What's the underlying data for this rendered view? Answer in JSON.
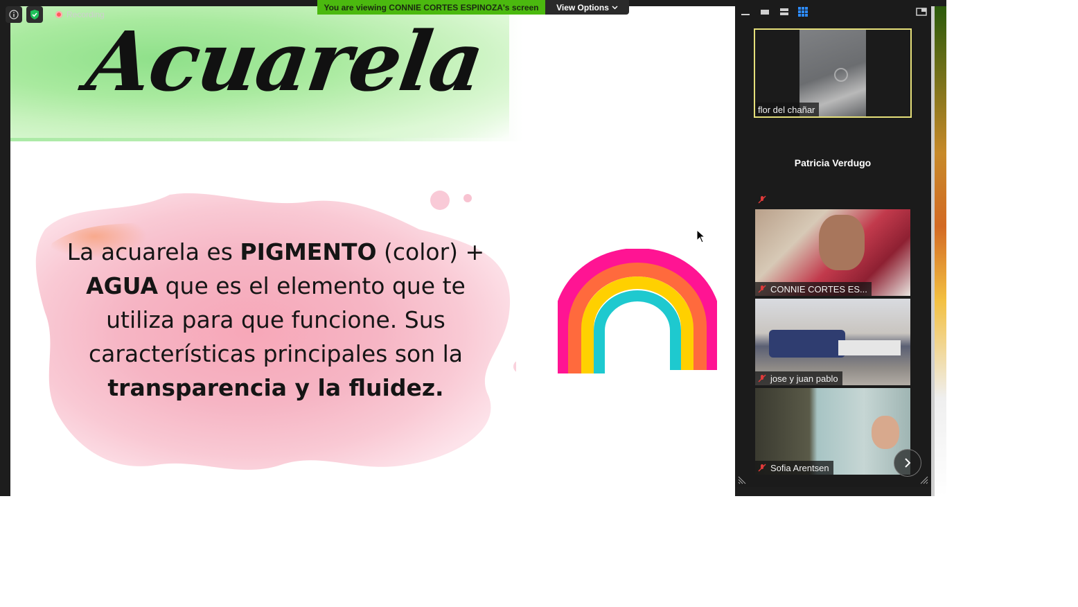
{
  "meeting": {
    "recording_label": "Recording",
    "viewing_banner": "You are viewing CONNIE CORTES ESPINOZA's screen",
    "view_options_label": "View Options"
  },
  "slide": {
    "title": "Acuarela",
    "text_parts": [
      "La acuarela es ",
      "PIGMENTO",
      " (color) + ",
      "AGUA",
      " que es el elemento que te utiliza para que funcione. Sus características principales son la ",
      "transparencia y la fluidez."
    ]
  },
  "participants": [
    {
      "name": "flor del chañar",
      "muted": false,
      "active": true
    },
    {
      "name": "Patricia Verdugo",
      "muted": true,
      "video": false
    },
    {
      "name": "CONNIE CORTES ES...",
      "muted": true
    },
    {
      "name": "jose y juan pablo",
      "muted": true
    },
    {
      "name": "Sofia Arentsen",
      "muted": true
    }
  ],
  "colors": {
    "banner_green": "#4bb90f",
    "active_speaker": "#e6e07a",
    "panel_bg": "#1b1b1b"
  },
  "icons": [
    "info-icon",
    "shield-check-icon",
    "record-icon",
    "chevron-down-icon",
    "minimize-icon",
    "speaker-view-icon",
    "strip-view-icon",
    "grid-view-icon",
    "popout-icon",
    "mic-muted-icon",
    "chevron-right-icon",
    "resize-handle-icon"
  ]
}
